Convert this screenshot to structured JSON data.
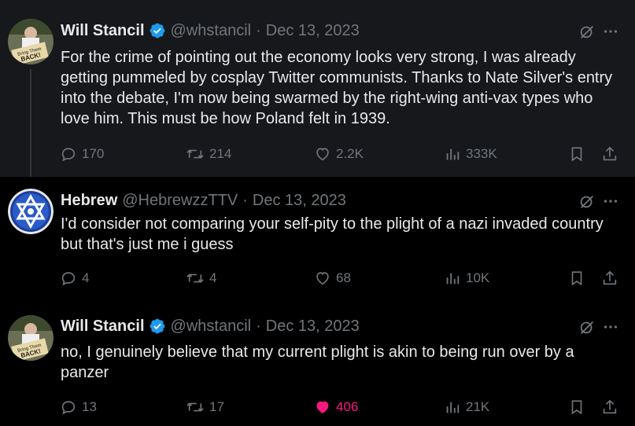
{
  "tweets": [
    {
      "name": "Will Stancil",
      "verified": true,
      "handle": "@whstancil",
      "date": "Dec 13, 2023",
      "text": "For the crime of pointing out the economy looks very strong, I was already getting pummeled by cosplay Twitter communists. Thanks to Nate Silver's entry into the debate, I'm now being swarmed by the right-wing anti-vax types who love him. This must be how Poland felt in 1939.",
      "replies": "170",
      "reposts": "214",
      "likes": "2.2K",
      "views": "333K",
      "liked": false,
      "avatar_sign": "Bring Them BACK!"
    },
    {
      "name": "Hebrew",
      "verified": false,
      "handle": "@HebrewzzTTV",
      "date": "Dec 13, 2023",
      "text": "I'd consider not comparing your self-pity to the plight of a nazi invaded country but that's just me i guess",
      "replies": "4",
      "reposts": "4",
      "likes": "68",
      "views": "10K",
      "liked": false
    },
    {
      "name": "Will Stancil",
      "verified": true,
      "handle": "@whstancil",
      "date": "Dec 13, 2023",
      "text": "no, I genuinely believe that my current plight is akin to being run over by a panzer",
      "replies": "13",
      "reposts": "17",
      "likes": "406",
      "views": "21K",
      "liked": true,
      "avatar_sign": "Bring Them BACK!"
    }
  ],
  "colors": {
    "background": "#000000",
    "highlight_background": "#16181c",
    "text": "#e7e9ea",
    "muted": "#71767b",
    "verified_blue": "#1d9bf0",
    "like_pink": "#f91880"
  },
  "icons": [
    "reply-icon",
    "repost-icon",
    "like-icon",
    "views-icon",
    "bookmark-icon",
    "share-icon",
    "grok-icon",
    "more-icon",
    "verified-badge-icon"
  ]
}
